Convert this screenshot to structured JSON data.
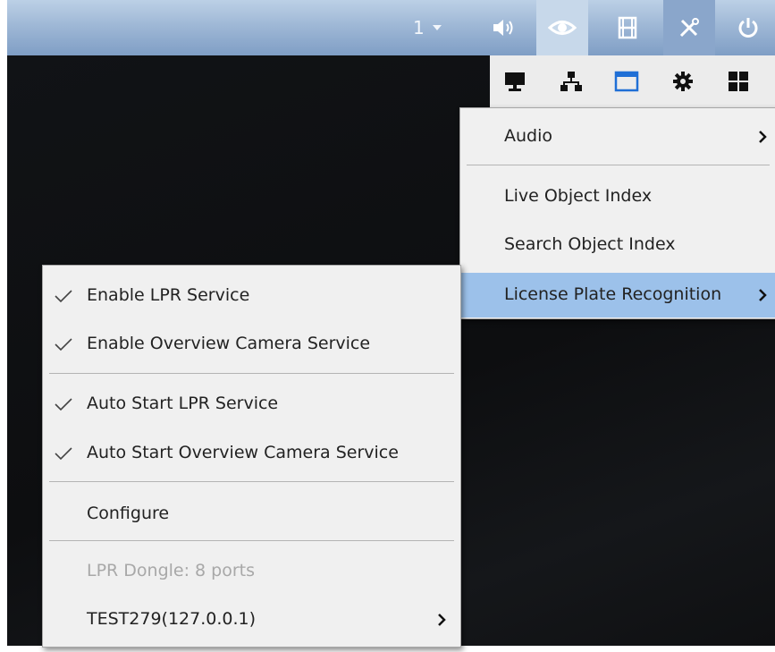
{
  "toolbar": {
    "stream_selector": {
      "value": "1"
    },
    "icons": [
      "volume-icon",
      "eye-icon",
      "film-icon",
      "tools-icon",
      "power-icon"
    ]
  },
  "iconbar": {
    "icons": [
      "monitor-icon",
      "network-icon",
      "window-icon",
      "gear-icon",
      "grid-icon"
    ]
  },
  "main_menu": {
    "items": [
      {
        "label": "Audio"
      },
      {
        "label": "Live Object Index"
      },
      {
        "label": "Search Object Index"
      },
      {
        "label": "License Plate Recognition"
      }
    ]
  },
  "lpr_menu": {
    "items": [
      {
        "label": "Enable LPR Service"
      },
      {
        "label": "Enable Overview Camera Service"
      },
      {
        "label": "Auto Start LPR Service"
      },
      {
        "label": "Auto Start Overview Camera Service"
      },
      {
        "label": "Configure"
      },
      {
        "label": "LPR Dongle: 8 ports"
      },
      {
        "label": "TEST279(127.0.0.1)"
      }
    ]
  },
  "colors": {
    "toolbar_gradient_top": "#bcd0e6",
    "toolbar_gradient_bottom": "#7f9ec5",
    "menu_background": "#f0f0f0",
    "menu_highlight": "#9cc1ea",
    "video_background": "#0e0f11"
  }
}
